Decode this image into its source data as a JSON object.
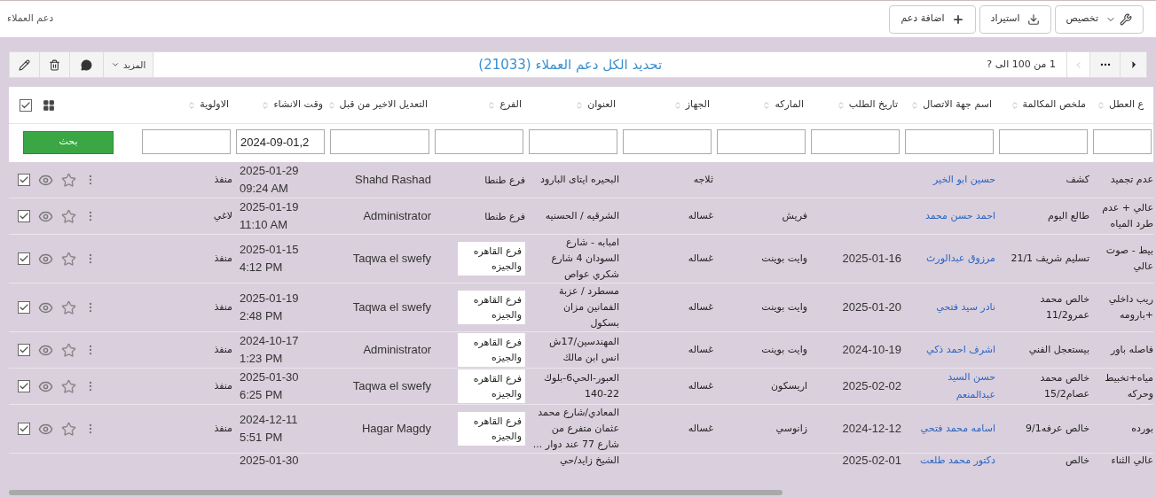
{
  "page": {
    "title": "دعم العملاء"
  },
  "toolbar": [
    {
      "kind": "customize",
      "label": "تخصيص"
    },
    {
      "kind": "import",
      "label": "استيراد"
    },
    {
      "kind": "add",
      "label": "اضافة دعم"
    }
  ],
  "list_bar": {
    "more_label": "المزيد",
    "title": "تحديد الكل دعم العملاء (21033)",
    "pager": "1 من 100 الى ?"
  },
  "table": {
    "select_all_checked": true,
    "search_label": "بحث",
    "columns": [
      {
        "kind": "text",
        "label": "ع العطل"
      },
      {
        "kind": "text",
        "label": "ملخص المكالمة"
      },
      {
        "kind": "link",
        "label": "اسم جهة الاتصال"
      },
      {
        "kind": "latin",
        "label": "تاريخ الطلب"
      },
      {
        "kind": "text",
        "label": "الماركه"
      },
      {
        "kind": "text",
        "label": "الجهاز"
      },
      {
        "kind": "text",
        "label": "العنوان"
      },
      {
        "kind": "branch",
        "label": "الفرع"
      },
      {
        "kind": "latin",
        "label": "التعديل الاخير من قبل"
      },
      {
        "kind": "datetime",
        "label": "وقت الانشاء",
        "filter_value": "2024-09-01,2"
      },
      {
        "kind": "text",
        "label": "الاولوية"
      }
    ],
    "rows": [
      {
        "checked": true,
        "starred": false,
        "branch_boxed": false,
        "cells": [
          "عدم تجميد",
          "كشف",
          "حسين ابو الخير",
          null,
          null,
          "ثلاجه",
          "البحيره ايتاى البارود",
          "فرع طنطا",
          "Shahd Rashad",
          "2025-01-29 09:24 AM",
          "منفذ"
        ]
      },
      {
        "checked": true,
        "starred": false,
        "branch_boxed": false,
        "cells": [
          "عالي + عدم طرد المياه",
          "طالع اليوم",
          "احمد حسن محمد",
          null,
          "فريش",
          "غساله",
          "الشرقيه / الحسنيه",
          "فرع طنطا",
          "Administrator",
          "2025-01-19 11:10 AM",
          "لاغي"
        ]
      },
      {
        "checked": true,
        "starred": false,
        "branch_boxed": true,
        "cells": [
          "بيط - صوت عالي",
          "تسليم شريف 21/1",
          "مرزوق عبدالورث",
          "2025-01-16",
          "وايت بوينت",
          "غساله",
          "امبابه - شارع السودان 4 شارع شكري عواص",
          "فرع القاهره والجيزه",
          "Taqwa el swefy",
          "2025-01-15 4:12 PM",
          "منفذ"
        ]
      },
      {
        "checked": true,
        "starred": false,
        "branch_boxed": true,
        "cells": [
          "ريب داخلي +بارومه",
          "خالص محمد عمرو11/2",
          "نادر سيد فتحي",
          "2025-01-20",
          "وايت بوينت",
          "غساله",
          "مسطرد / عزبة الفمانين مزان بسكول",
          "فرع القاهره والجيزه",
          "Taqwa el swefy",
          "2025-01-19 2:48 PM",
          "منفذ"
        ]
      },
      {
        "checked": true,
        "starred": false,
        "branch_boxed": true,
        "cells": [
          "فاصله باور",
          "بيستعجل الفني",
          "اشرف احمد ذكي",
          "2024-10-19",
          "وايت بوينت",
          "غساله",
          "المهندسين/17ش انس ابن مالك",
          "فرع القاهره والجيزه",
          "Administrator",
          "2024-10-17 1:23 PM",
          "منفذ"
        ]
      },
      {
        "checked": true,
        "starred": false,
        "branch_boxed": true,
        "cells": [
          "مياه+تخبيط وحركه",
          "خالص محمد عصام15/2",
          "حسن السيد عبدالمنعم",
          "2025-02-02",
          "اريسكون",
          "غساله",
          "العبور-الحي6-بلوك 22-140",
          "فرع القاهره والجيزه",
          "Taqwa el swefy",
          "2025-01-30 6:25 PM",
          "منفذ"
        ]
      },
      {
        "checked": true,
        "starred": false,
        "branch_boxed": true,
        "cells": [
          "بورده",
          "خالص عرفه9/1",
          "اسامه محمد فتحي",
          "2024-12-12",
          "زانوسي",
          "غساله",
          "المعادي/شارع محمد عثمان متفرع من شارع 77 عند دوار ...",
          "فرع القاهره والجيزه",
          "Hagar Magdy",
          "2024-12-11 5:51 PM",
          "منفذ"
        ]
      }
    ],
    "partial_row": {
      "cells": [
        "عالي الثناء",
        "خالص",
        "دكتور محمد طلعت",
        "2025-02-01",
        null,
        null,
        "الشيخ زايد/حي",
        null,
        null,
        "2025-01-30",
        null
      ]
    }
  }
}
